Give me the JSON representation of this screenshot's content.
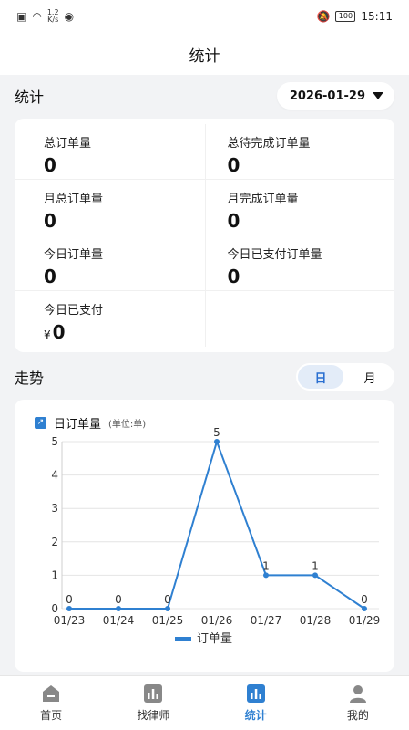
{
  "status_bar": {
    "speed_value": "1.2",
    "speed_unit": "K/s",
    "battery": "100",
    "time": "15:11"
  },
  "header": {
    "title": "统计"
  },
  "stats": {
    "section_title": "统计",
    "date": "2026-01-29",
    "items": [
      {
        "label": "总订单量",
        "value": "0"
      },
      {
        "label": "总待完成订单量",
        "value": "0"
      },
      {
        "label": "月总订单量",
        "value": "0"
      },
      {
        "label": "月完成订单量",
        "value": "0"
      },
      {
        "label": "今日订单量",
        "value": "0"
      },
      {
        "label": "今日已支付订单量",
        "value": "0"
      },
      {
        "label": "今日已支付",
        "currency": "¥",
        "value": "0"
      }
    ]
  },
  "trend": {
    "section_title": "走势",
    "toggle": {
      "day": "日",
      "month": "月",
      "selected": "day"
    }
  },
  "chart_data": {
    "type": "line",
    "title": "日订单量",
    "unit_note": "(单位:单)",
    "categories": [
      "01/23",
      "01/24",
      "01/25",
      "01/26",
      "01/27",
      "01/28",
      "01/29"
    ],
    "series": [
      {
        "name": "订单量",
        "values": [
          0,
          0,
          0,
          5,
          1,
          1,
          0
        ]
      }
    ],
    "ylim": [
      0,
      5
    ],
    "yticks": [
      "0",
      "1",
      "2",
      "3",
      "4",
      "5"
    ],
    "grid": true,
    "legend_position": "bottom",
    "color": "#2f80d1"
  },
  "tabs": [
    {
      "label": "首页",
      "icon": "home-icon",
      "active": false
    },
    {
      "label": "找律师",
      "icon": "lawyer-chart-icon",
      "active": false
    },
    {
      "label": "统计",
      "icon": "stats-icon",
      "active": true
    },
    {
      "label": "我的",
      "icon": "user-icon",
      "active": false
    }
  ],
  "colors": {
    "accent": "#2f80d1",
    "background": "#f2f3f5",
    "card": "#ffffff"
  }
}
